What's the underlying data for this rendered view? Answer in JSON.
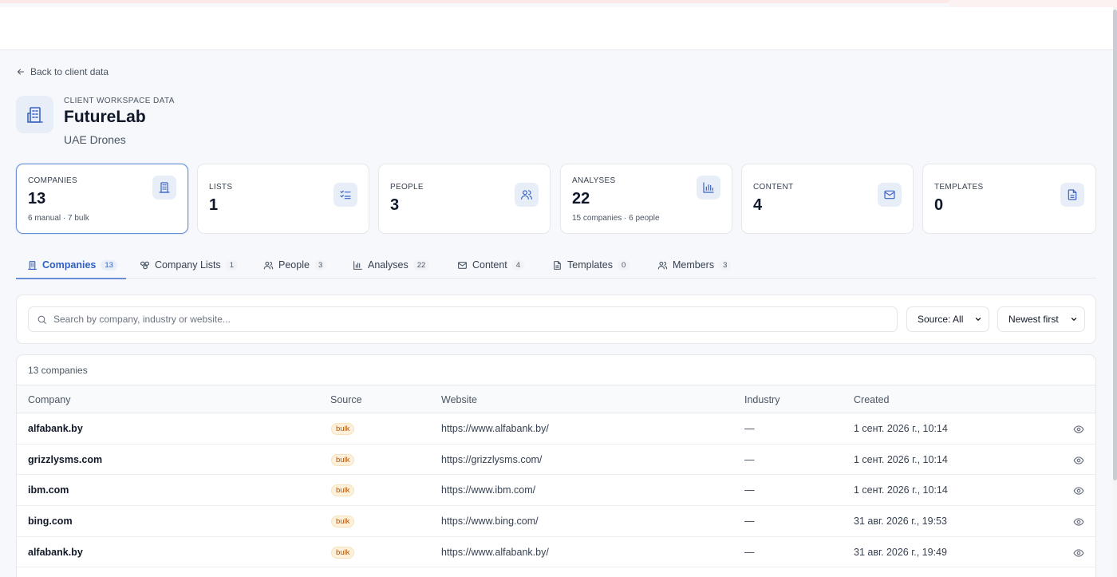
{
  "back_link": {
    "label": "Back to client data"
  },
  "workspace": {
    "eyebrow": "CLIENT WORKSPACE DATA",
    "title": "FutureLab",
    "subtitle": "UAE Drones"
  },
  "stats": [
    {
      "label": "COMPANIES",
      "value": "13",
      "note": "6 manual · 7 bulk",
      "icon": "building-icon"
    },
    {
      "label": "LISTS",
      "value": "1",
      "note": "",
      "icon": "list-check-icon"
    },
    {
      "label": "PEOPLE",
      "value": "3",
      "note": "",
      "icon": "users-icon"
    },
    {
      "label": "ANALYSES",
      "value": "22",
      "note": "15 companies · 6 people",
      "icon": "bar-chart-icon"
    },
    {
      "label": "CONTENT",
      "value": "4",
      "note": "",
      "icon": "mail-icon"
    },
    {
      "label": "TEMPLATES",
      "value": "0",
      "note": "",
      "icon": "file-text-icon"
    }
  ],
  "tabs": [
    {
      "label": "Companies",
      "count": "13",
      "icon": "building-icon"
    },
    {
      "label": "Company Lists",
      "count": "1",
      "icon": "boxes-icon"
    },
    {
      "label": "People",
      "count": "3",
      "icon": "users-icon"
    },
    {
      "label": "Analyses",
      "count": "22",
      "icon": "bar-chart-icon"
    },
    {
      "label": "Content",
      "count": "4",
      "icon": "mail-icon"
    },
    {
      "label": "Templates",
      "count": "0",
      "icon": "file-text-icon"
    },
    {
      "label": "Members",
      "count": "3",
      "icon": "users-icon"
    }
  ],
  "filters": {
    "search_placeholder": "Search by company, industry or website...",
    "source_select": "Source: All",
    "sort_select": "Newest first"
  },
  "table": {
    "count_label": "13 companies",
    "columns": [
      "Company",
      "Source",
      "Website",
      "Industry",
      "Created"
    ],
    "rows": [
      {
        "company": "alfabank.by",
        "source": "bulk",
        "website": "https://www.alfabank.by/",
        "industry": "—",
        "created": "1 сент. 2026 г., 10:14"
      },
      {
        "company": "grizzlysms.com",
        "source": "bulk",
        "website": "https://grizzlysms.com/",
        "industry": "—",
        "created": "1 сент. 2026 г., 10:14"
      },
      {
        "company": "ibm.com",
        "source": "bulk",
        "website": "https://www.ibm.com/",
        "industry": "—",
        "created": "1 сент. 2026 г., 10:14"
      },
      {
        "company": "bing.com",
        "source": "bulk",
        "website": "https://www.bing.com/",
        "industry": "—",
        "created": "31 авг. 2026 г., 19:53"
      },
      {
        "company": "alfabank.by",
        "source": "bulk",
        "website": "https://www.alfabank.by/",
        "industry": "—",
        "created": "31 авг. 2026 г., 19:49"
      }
    ]
  },
  "colors": {
    "accent": "#2f5fc4",
    "accent_border": "#6b8fd6",
    "icon_bg": "#e8eef8",
    "badge_text": "#b45309",
    "badge_bg": "#fdf1dc"
  }
}
